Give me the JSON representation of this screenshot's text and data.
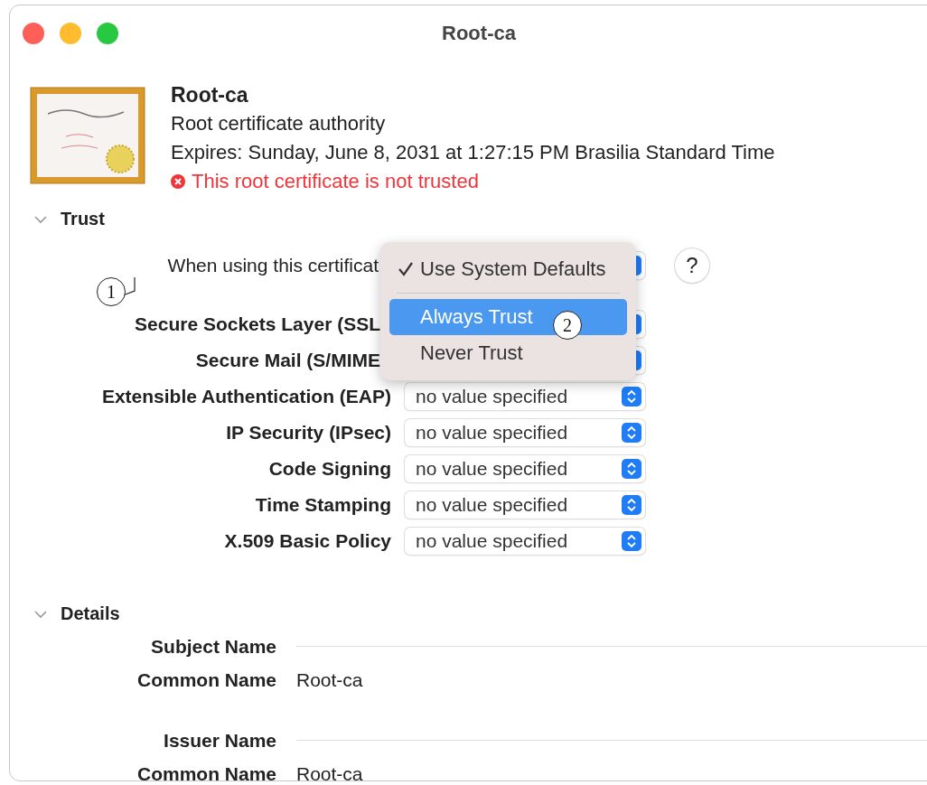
{
  "window": {
    "title": "Root-ca"
  },
  "certificate": {
    "name": "Root-ca",
    "description": "Root certificate authority",
    "expires": "Expires: Sunday, June 8, 2031 at 1:27:15 PM Brasilia Standard Time",
    "status": "This root certificate is not trusted"
  },
  "trust": {
    "label": "Trust",
    "expanded": true,
    "when_using": "When using this certificat",
    "help": "?",
    "rows": [
      {
        "label": "Secure Sockets Layer (SSL"
      },
      {
        "label": "Secure Mail (S/MIME"
      },
      {
        "label": "Extensible Authentication (EAP)",
        "value": "no value specified"
      },
      {
        "label": "IP Security (IPsec)",
        "value": "no value specified"
      },
      {
        "label": "Code Signing",
        "value": "no value specified"
      },
      {
        "label": "Time Stamping",
        "value": "no value specified"
      },
      {
        "label": "X.509 Basic Policy",
        "value": "no value specified"
      }
    ]
  },
  "menu": {
    "items": [
      {
        "label": "Use System Defaults",
        "checked": true,
        "selected": false
      },
      {
        "label": "Always Trust",
        "checked": false,
        "selected": true
      },
      {
        "label": "Never Trust",
        "checked": false,
        "selected": false
      }
    ]
  },
  "annotations": [
    {
      "label": "1"
    },
    {
      "label": "2"
    }
  ],
  "details": {
    "label": "Details",
    "expanded": true,
    "groups": [
      {
        "heading": "Subject Name",
        "fields": [
          {
            "label": "Common Name",
            "value": "Root-ca"
          }
        ]
      },
      {
        "heading": "Issuer Name",
        "fields": [
          {
            "label": "Common Name",
            "value": "Root-ca"
          }
        ]
      }
    ]
  }
}
